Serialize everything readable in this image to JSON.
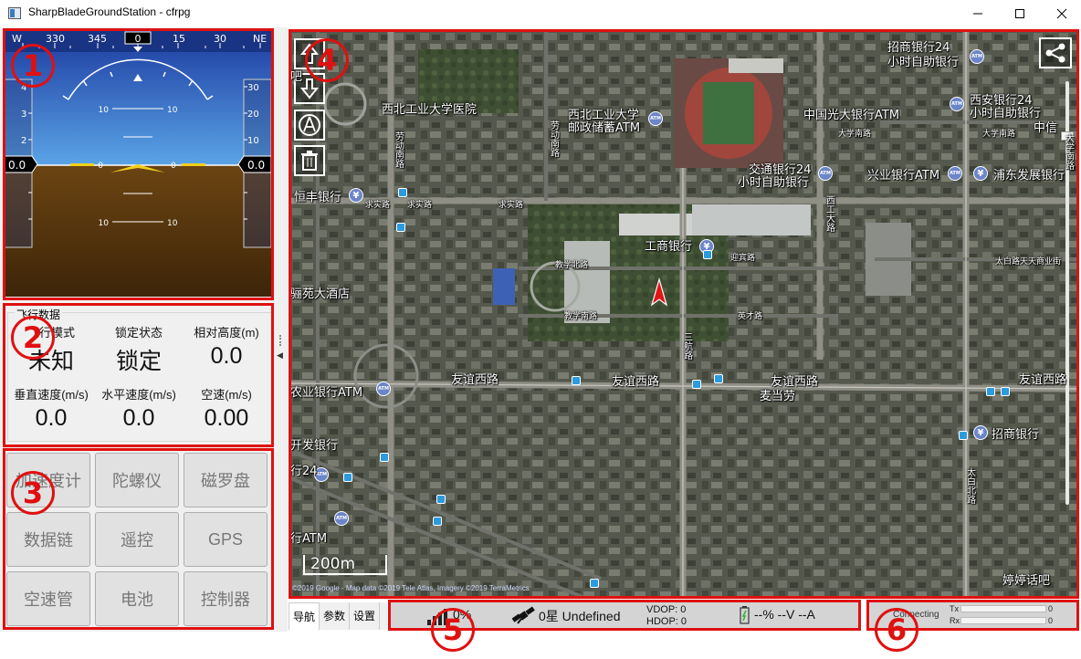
{
  "window": {
    "title": "SharpBladeGroundStation - cfrpg"
  },
  "pfd": {
    "compass_ticks": [
      "W",
      "330",
      "345",
      "0",
      "15",
      "30",
      "NE"
    ],
    "heading_value": "0",
    "speed_scale": [
      "4",
      "3",
      "2",
      "1"
    ],
    "alt_scale": [
      "30",
      "20",
      "10"
    ],
    "speed_readout": "0.0",
    "alt_readout": "0.0",
    "pitch_labels": [
      "10",
      "10",
      "0",
      "0",
      "10",
      "10"
    ]
  },
  "flight_data": {
    "legend": "飞行数据",
    "cells": [
      {
        "label": "飞行模式",
        "value": "未知"
      },
      {
        "label": "锁定状态",
        "value": "锁定"
      },
      {
        "label": "相对高度(m)",
        "value": "0.0"
      },
      {
        "label": "垂直速度(m/s)",
        "value": "0.0"
      },
      {
        "label": "水平速度(m/s)",
        "value": "0.0"
      },
      {
        "label": "空速(m/s)",
        "value": "0.00"
      }
    ]
  },
  "sensors": [
    "加速度计",
    "陀螺仪",
    "磁罗盘",
    "数据链",
    "遥控",
    "GPS",
    "空速管",
    "电池",
    "控制器"
  ],
  "map": {
    "labels": [
      "招商银行24",
      "小时自助银行",
      "西安银行24",
      "小时自助银行",
      "中国光大银行ATM",
      "中信",
      "西北工业大学医院",
      "西北工业大学",
      "邮政储蓄ATM",
      "交通银行24",
      "小时自助银行",
      "兴业银行ATM",
      "浦东发展银行",
      "恒丰银行",
      "工商银行",
      "骊苑大酒店",
      "友谊西路",
      "友谊西路",
      "友谊西路",
      "友谊西路",
      "农业银行ATM",
      "麦当劳",
      "招商银行",
      "开发银行",
      "行24",
      "行ATM",
      "婷婷话吧",
      "吧"
    ],
    "small_labels": [
      "求实路",
      "求实路",
      "求实路",
      "教学北路",
      "教学南路",
      "迎宾路",
      "英才路",
      "大学南路",
      "大学南路",
      "太白路天天商业街"
    ],
    "vertical_labels": [
      "劳动南路",
      "劳动南路",
      "西工大路",
      "三航路",
      "太白北路",
      "大学南路"
    ],
    "scale": "200m",
    "attribution": "©2019 Google - Map data ©2019 Tele Atlas, Imagery ©2019 TerraMetrics"
  },
  "tabs": [
    "导航",
    "参数",
    "设置"
  ],
  "status": {
    "signal": "0%",
    "satellites": "0星 Undefined",
    "vdop": "VDOP:  0",
    "hdop": "HDOP:  0",
    "battery": "--% --V --A"
  },
  "link": {
    "status": "Connecting",
    "tx_label": "Tx",
    "rx_label": "Rx",
    "tx_value": "0",
    "rx_value": "0"
  },
  "annotations": [
    "1",
    "2",
    "3",
    "4",
    "5",
    "6"
  ]
}
